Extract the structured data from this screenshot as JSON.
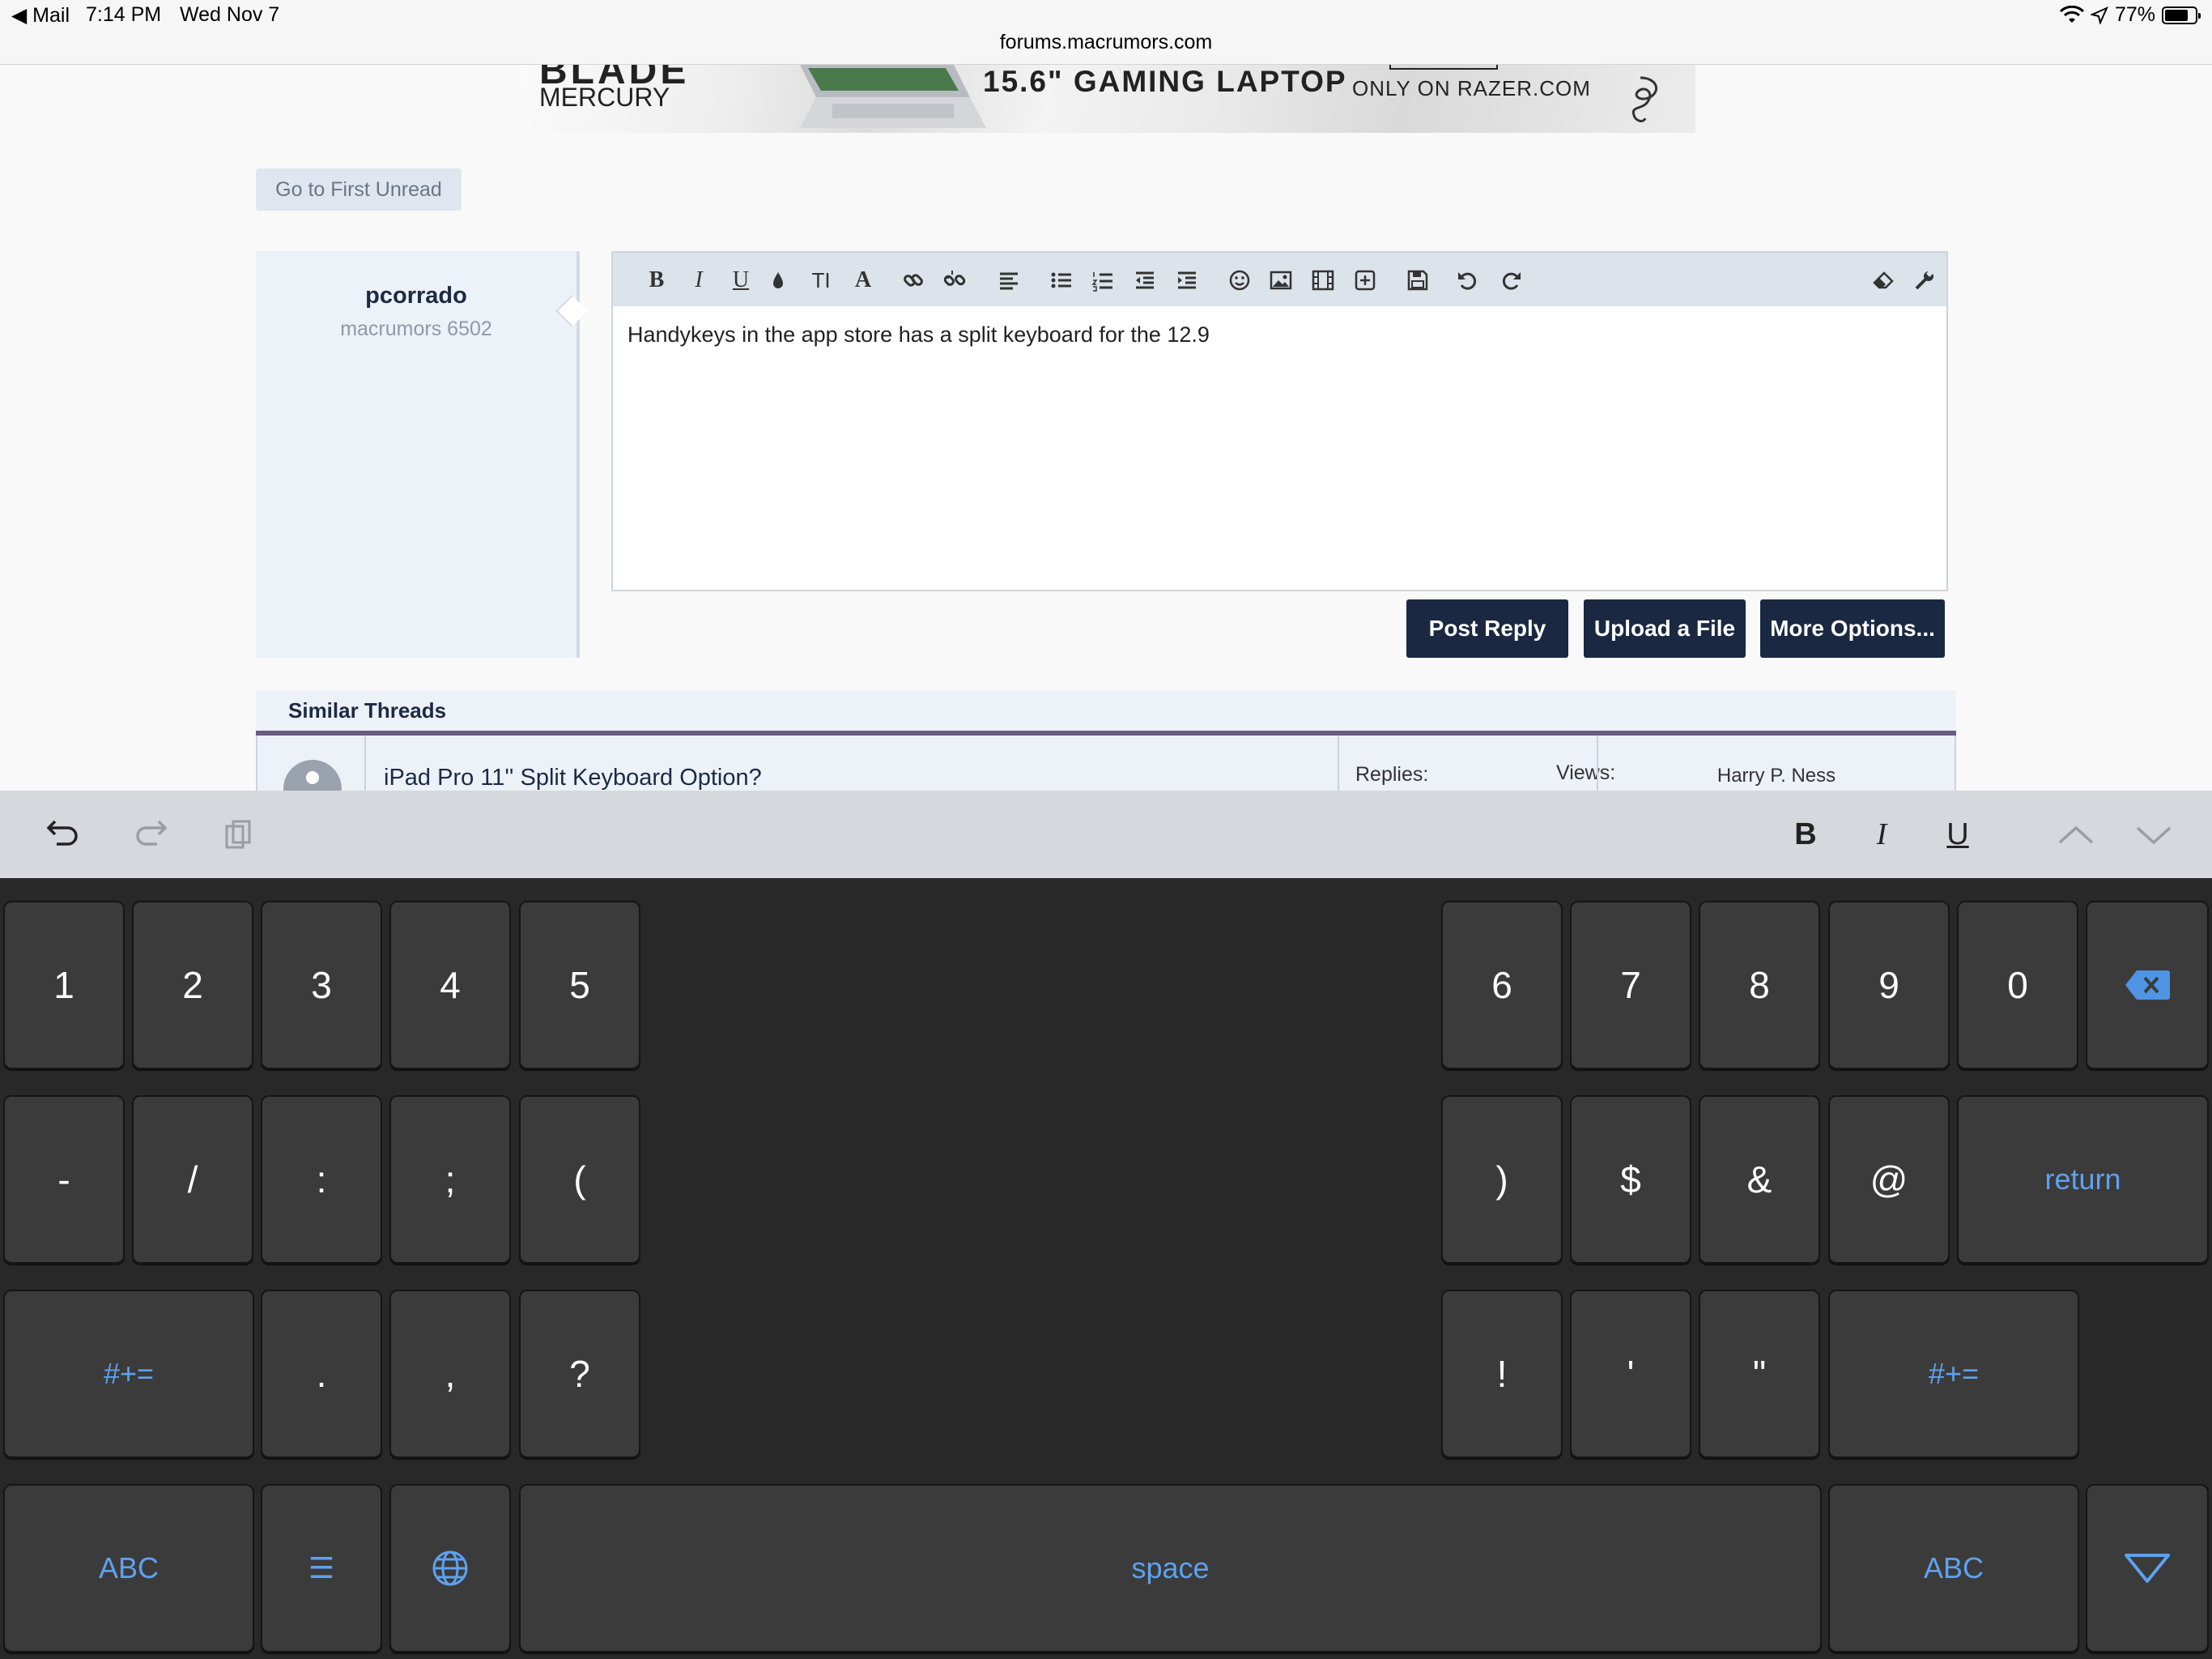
{
  "status_bar": {
    "back_app": "◀ Mail",
    "time": "7:14 PM",
    "date": "Wed Nov 7",
    "url": "forums.macrumors.com",
    "battery": "77%",
    "battery_level": 0.77
  },
  "ad": {
    "brand_top": "BLADE",
    "brand": "MERCURY",
    "headline": "15.6\" GAMING LAPTOP",
    "cta": "ONLY ON RAZER.COM"
  },
  "page": {
    "first_unread": "Go to First Unread",
    "user": {
      "name": "pcorrado",
      "title": "macrumors 6502"
    },
    "editor": {
      "toolbar": [
        "bold-icon",
        "italic-icon",
        "underline-icon",
        "color-icon",
        "text-size-icon",
        "font-icon",
        "link-icon",
        "unlink-icon",
        "align-icon",
        "bullet-list-icon",
        "number-list-icon",
        "outdent-icon",
        "indent-icon",
        "smilie-icon",
        "image-icon",
        "media-icon",
        "insert-icon",
        "save-draft-icon",
        "undo-icon",
        "redo-icon",
        "remove-format-icon",
        "settings-icon"
      ],
      "text": "Handykeys in the app store has a split keyboard for the 12.9"
    },
    "buttons": {
      "post": "Post Reply",
      "upload": "Upload a File",
      "more": "More Options..."
    },
    "similar_threads": {
      "title": "Similar Threads",
      "rows": [
        {
          "title": "iPad Pro 11'' Split Keyboard Option?",
          "replies_label": "Replies:",
          "views_label": "Views:",
          "last_poster": "Harry P. Ness"
        }
      ]
    }
  },
  "keyboard": {
    "shortcut_bar": {
      "left": [
        "undo-icon",
        "redo-icon",
        "paste-icon"
      ],
      "format": [
        "B",
        "I",
        "U"
      ],
      "nav": [
        "chevron-up-icon",
        "chevron-down-icon"
      ]
    },
    "left_rows": [
      [
        "1",
        "2",
        "3",
        "4",
        "5"
      ],
      [
        "-",
        "/",
        ":",
        ";",
        "("
      ],
      [
        "#+=",
        ".",
        ",",
        "?"
      ],
      [
        "ABC",
        "☰",
        "globe-icon"
      ]
    ],
    "right_rows": [
      [
        "6",
        "7",
        "8",
        "9",
        "0",
        "delete-icon"
      ],
      [
        ")",
        "$",
        "&",
        "@",
        "return"
      ],
      [
        "!",
        "'",
        "\"",
        "#+="
      ],
      [
        "ABC",
        "dismiss-keyboard-icon"
      ]
    ],
    "space": "space"
  }
}
